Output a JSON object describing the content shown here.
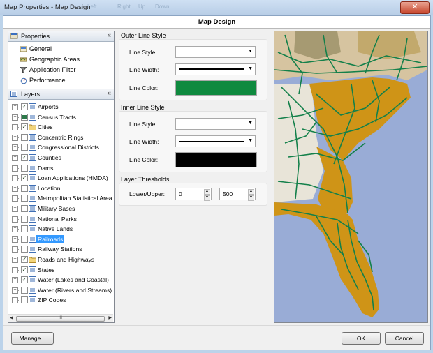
{
  "window": {
    "title": "Map Properties - Map Design",
    "ghost_menu": [
      "Left",
      "Right",
      "Up",
      "Down"
    ],
    "close_glyph": "✕"
  },
  "header": {
    "title": "Map Design"
  },
  "properties_panel": {
    "title": "Properties",
    "collapse_glyph": "«",
    "items": [
      {
        "label": "General",
        "icon": "general-icon"
      },
      {
        "label": "Geographic Areas",
        "icon": "geographic-areas-icon"
      },
      {
        "label": "Application Filter",
        "icon": "filter-icon"
      },
      {
        "label": "Performance",
        "icon": "performance-icon"
      }
    ]
  },
  "layers_panel": {
    "title": "Layers",
    "collapse_glyph": "«",
    "items": [
      {
        "label": "Airports",
        "checked": true,
        "icon": "layer-icon"
      },
      {
        "label": "Census Tracts",
        "checked": "partial",
        "icon": "layer-icon"
      },
      {
        "label": "Cities",
        "checked": true,
        "icon": "folder-icon"
      },
      {
        "label": "Concentric Rings",
        "checked": false,
        "icon": "layer-icon"
      },
      {
        "label": "Congressional Districts",
        "checked": false,
        "icon": "layer-icon"
      },
      {
        "label": "Counties",
        "checked": true,
        "icon": "layer-icon"
      },
      {
        "label": "Dams",
        "checked": false,
        "icon": "layer-icon"
      },
      {
        "label": "Loan Applications (HMDA)",
        "checked": true,
        "icon": "layer-icon"
      },
      {
        "label": "Location",
        "checked": false,
        "icon": "layer-icon"
      },
      {
        "label": "Metropolitan Statistical Area",
        "checked": false,
        "icon": "layer-icon"
      },
      {
        "label": "Military Bases",
        "checked": false,
        "icon": "layer-icon"
      },
      {
        "label": "National Parks",
        "checked": false,
        "icon": "layer-icon"
      },
      {
        "label": "Native Lands",
        "checked": false,
        "icon": "layer-icon"
      },
      {
        "label": "Railroads",
        "checked": false,
        "icon": "layer-icon",
        "selected": true
      },
      {
        "label": "Railway Stations",
        "checked": false,
        "icon": "layer-icon"
      },
      {
        "label": "Roads and Highways",
        "checked": true,
        "icon": "folder-icon"
      },
      {
        "label": "States",
        "checked": true,
        "icon": "layer-icon"
      },
      {
        "label": "Water (Lakes and Coastal)",
        "checked": true,
        "icon": "layer-icon"
      },
      {
        "label": "Water (Rivers and Streams)",
        "checked": false,
        "icon": "layer-icon"
      },
      {
        "label": "ZIP Codes",
        "checked": false,
        "icon": "layer-icon"
      }
    ],
    "scroll_thumb_glyph": "III"
  },
  "outer_line_style": {
    "group_title": "Outer Line Style",
    "line_style_label": "Line Style:",
    "line_width_label": "Line Width:",
    "line_color_label": "Line Color:",
    "line_color": "#0f8a3f"
  },
  "inner_line_style": {
    "group_title": "Inner Line Style",
    "line_style_label": "Line Style:",
    "line_width_label": "Line Width:",
    "line_color_label": "Line Color:",
    "line_color": "#000000"
  },
  "layer_thresholds": {
    "group_title": "Layer Thresholds",
    "label": "Lower/Upper:",
    "lower": "0",
    "upper": "500"
  },
  "buttons": {
    "manage": "Manage...",
    "ok": "OK",
    "cancel": "Cancel"
  },
  "map": {
    "colors": {
      "water": "#99acd6",
      "highlighted_state": "#cf9417",
      "other_land": "#e8e4d8",
      "light_land": "#d6c4a0",
      "railroads": "#13804a"
    }
  }
}
